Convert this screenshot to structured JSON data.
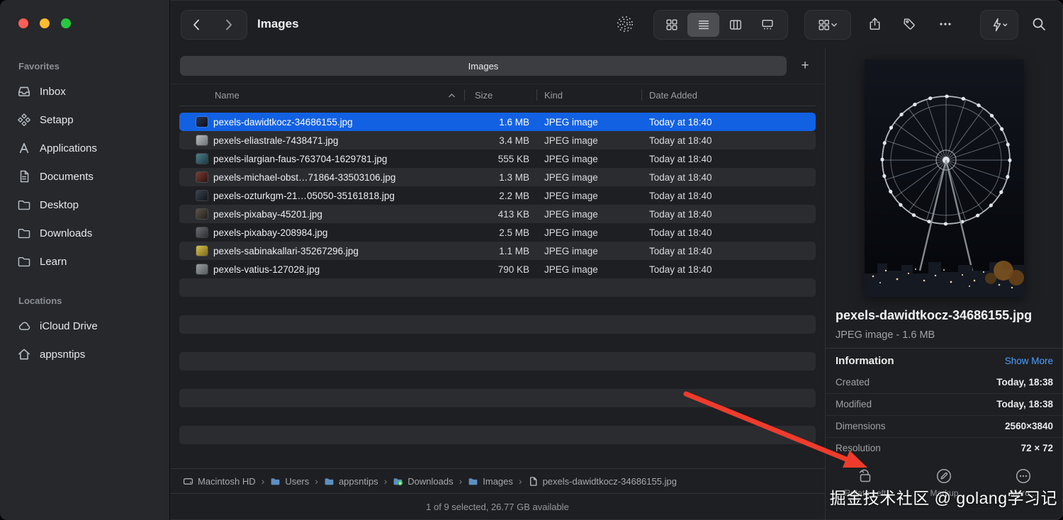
{
  "window": {
    "title": "Images"
  },
  "toolbar": {
    "title": "Images",
    "icons": [
      "back-icon",
      "forward-icon",
      "airdrop-icon",
      "grid-view-icon",
      "list-view-icon",
      "column-view-icon",
      "gallery-view-icon",
      "group-by-icon",
      "share-icon",
      "tags-icon",
      "more-icon",
      "quick-actions-icon",
      "search-icon"
    ]
  },
  "sidebar": {
    "sections": [
      {
        "label": "Favorites",
        "items": [
          {
            "label": "Inbox",
            "icon": "inbox-icon"
          },
          {
            "label": "Setapp",
            "icon": "setapp-icon"
          },
          {
            "label": "Applications",
            "icon": "applications-icon"
          },
          {
            "label": "Documents",
            "icon": "documents-icon"
          },
          {
            "label": "Desktop",
            "icon": "folder-icon"
          },
          {
            "label": "Downloads",
            "icon": "folder-icon"
          },
          {
            "label": "Learn",
            "icon": "folder-icon"
          }
        ]
      },
      {
        "label": "Locations",
        "items": [
          {
            "label": "iCloud Drive",
            "icon": "icloud-icon"
          },
          {
            "label": "appsntips",
            "icon": "home-icon"
          }
        ]
      }
    ]
  },
  "tabbar": {
    "tab_label": "Images",
    "new_tab_icon": "+"
  },
  "list": {
    "columns": [
      "Name",
      "Size",
      "Kind",
      "Date Added"
    ],
    "rows": [
      {
        "name": "pexels-dawidtkocz-34686155.jpg",
        "size": "1.6 MB",
        "kind": "JPEG image",
        "date": "Today at 18:40",
        "selected": true
      },
      {
        "name": "pexels-eliastrale-7438471.jpg",
        "size": "3.4 MB",
        "kind": "JPEG image",
        "date": "Today at 18:40",
        "selected": false
      },
      {
        "name": "pexels-ilargian-faus-763704-1629781.jpg",
        "size": "555 KB",
        "kind": "JPEG image",
        "date": "Today at 18:40",
        "selected": false
      },
      {
        "name": "pexels-michael-obst…71864-33503106.jpg",
        "size": "1.3 MB",
        "kind": "JPEG image",
        "date": "Today at 18:40",
        "selected": false
      },
      {
        "name": "pexels-ozturkgm-21…05050-35161818.jpg",
        "size": "2.2 MB",
        "kind": "JPEG image",
        "date": "Today at 18:40",
        "selected": false
      },
      {
        "name": "pexels-pixabay-45201.jpg",
        "size": "413 KB",
        "kind": "JPEG image",
        "date": "Today at 18:40",
        "selected": false
      },
      {
        "name": "pexels-pixabay-208984.jpg",
        "size": "2.5 MB",
        "kind": "JPEG image",
        "date": "Today at 18:40",
        "selected": false
      },
      {
        "name": "pexels-sabinakallari-35267296.jpg",
        "size": "1.1 MB",
        "kind": "JPEG image",
        "date": "Today at 18:40",
        "selected": false
      },
      {
        "name": "pexels-vatius-127028.jpg",
        "size": "790 KB",
        "kind": "JPEG image",
        "date": "Today at 18:40",
        "selected": false
      }
    ]
  },
  "pathbar": {
    "separator": "›",
    "items": [
      {
        "label": "Macintosh HD",
        "icon": "disk-icon"
      },
      {
        "label": "Users",
        "icon": "folder-icon"
      },
      {
        "label": "appsntips",
        "icon": "folder-icon"
      },
      {
        "label": "Downloads",
        "icon": "downloads-folder-icon"
      },
      {
        "label": "Images",
        "icon": "folder-icon"
      },
      {
        "label": "pexels-dawidtkocz-34686155.jpg",
        "icon": "file-icon"
      }
    ]
  },
  "statusbar": {
    "text": "1 of 9 selected, 26.77 GB available"
  },
  "preview": {
    "filename": "pexels-dawidtkocz-34686155.jpg",
    "filetype_line": "JPEG image - 1.6 MB",
    "info_title": "Information",
    "show_more_label": "Show More",
    "fields": [
      {
        "label": "Created",
        "value": "Today, 18:38"
      },
      {
        "label": "Modified",
        "value": "Today, 18:38"
      },
      {
        "label": "Dimensions",
        "value": "2560×3840"
      },
      {
        "label": "Resolution",
        "value": "72 × 72"
      }
    ],
    "actions": [
      {
        "label": "Rotate Left",
        "icon": "rotate-left-icon"
      },
      {
        "label": "Markup",
        "icon": "markup-icon"
      },
      {
        "label": "More...",
        "icon": "more-circle-icon"
      }
    ]
  },
  "watermark": {
    "text": "掘金技术社区 @ golang学习记"
  },
  "colors": {
    "selection_blue": "#1261e3",
    "link_blue": "#4aa0ff",
    "arrow_red": "#ee3b2c",
    "traffic_red": "#ff5f57",
    "traffic_yellow": "#febc2e",
    "traffic_green": "#28c840"
  }
}
